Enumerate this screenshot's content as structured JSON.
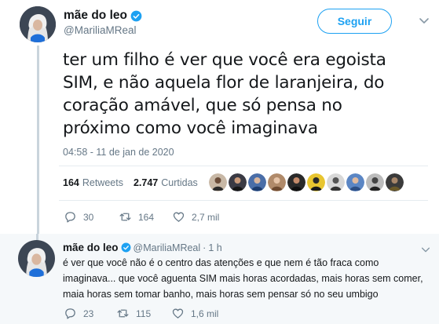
{
  "tweet": {
    "display_name": "mãe do leo",
    "handle": "@MariliaMReal",
    "follow_label": "Seguir",
    "text_lines": [
      "ter um filho é ver que você era egoista",
      "SIM, e não aquela flor de laranjeira, do",
      "coração amável, que só pensa no",
      "próximo como você imaginava"
    ],
    "timestamp": "04:58 - 11 de jan de 2020",
    "retweets_count": "164",
    "retweets_label": "Retweets",
    "likes_count": "2.747",
    "likes_label": "Curtidas",
    "liker_count_shown": 10,
    "actions": {
      "replies": "30",
      "retweets": "164",
      "likes": "2,7 mil"
    }
  },
  "reply": {
    "display_name": "mãe do leo",
    "handle": "@MariliaMReal",
    "separator": "·",
    "time": "1 h",
    "text_lines": [
      "é ver que você não é o centro das atenções e que nem é tão fraca como",
      "imaginava... que você aguenta SIM mais horas acordadas, mais horas sem comer,",
      "maia horas sem tomar banho, mais horas sem pensar só no seu umbigo"
    ],
    "actions": {
      "replies": "23",
      "retweets": "115",
      "likes": "1,6 mil"
    }
  },
  "icons": {
    "verified": "verified-badge-icon",
    "chevron": "chevron-down-icon",
    "reply": "reply-icon",
    "retweet": "retweet-icon",
    "like": "heart-icon"
  },
  "colors": {
    "accent": "#1da1f2",
    "text_primary": "#14171a",
    "text_secondary": "#657786",
    "reply_background": "#f5f8fa",
    "thread_line": "#c9d4dc"
  }
}
